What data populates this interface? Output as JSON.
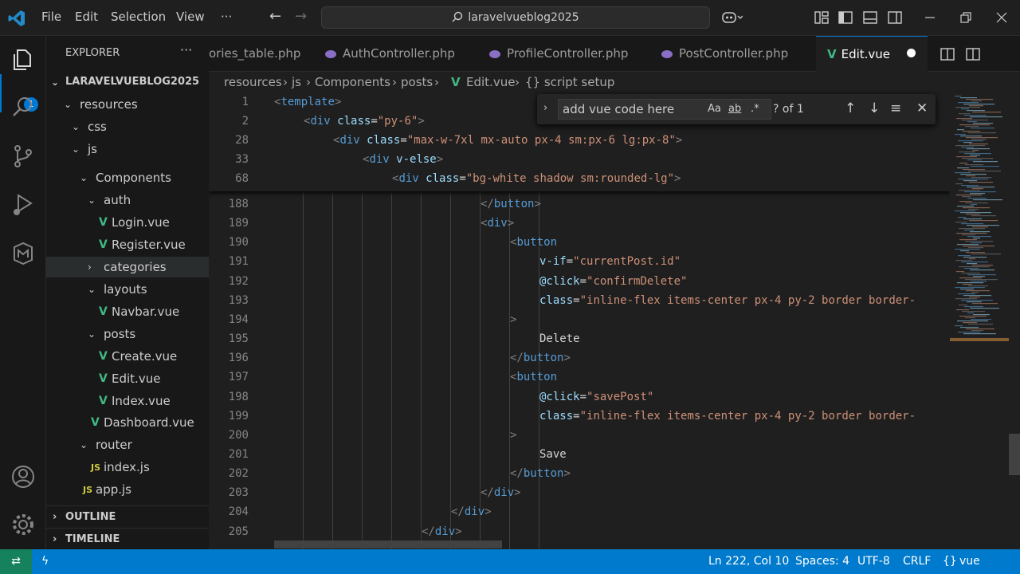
{
  "menu": [
    "File",
    "Edit",
    "Selection",
    "View",
    "···"
  ],
  "search": {
    "text": "laravelvueblog2025"
  },
  "activity": {
    "badge": "1"
  },
  "explorer": {
    "title": "EXPLORER",
    "more": "···",
    "root": "LARAVELVUEBLOG2025",
    "items": [
      {
        "label": "resources",
        "indent": 0,
        "type": "folder"
      },
      {
        "label": "css",
        "indent": 1,
        "type": "folder"
      },
      {
        "label": "js",
        "indent": 1,
        "type": "folder"
      },
      {
        "label": "Components",
        "indent": 2,
        "type": "folder"
      },
      {
        "label": "auth",
        "indent": 3,
        "type": "folder"
      },
      {
        "label": "Login.vue",
        "indent": 4,
        "type": "vue"
      },
      {
        "label": "Register.vue",
        "indent": 4,
        "type": "vue"
      },
      {
        "label": "categories",
        "indent": 3,
        "type": "folder-collapsed"
      },
      {
        "label": "layouts",
        "indent": 3,
        "type": "folder"
      },
      {
        "label": "Navbar.vue",
        "indent": 4,
        "type": "vue"
      },
      {
        "label": "posts",
        "indent": 3,
        "type": "folder"
      },
      {
        "label": "Create.vue",
        "indent": 4,
        "type": "vue"
      },
      {
        "label": "Edit.vue",
        "indent": 4,
        "type": "vue"
      },
      {
        "label": "Index.vue",
        "indent": 4,
        "type": "vue"
      },
      {
        "label": "Dashboard.vue",
        "indent": 3,
        "type": "vue"
      },
      {
        "label": "router",
        "indent": 2,
        "type": "folder"
      },
      {
        "label": "index.js",
        "indent": 3,
        "type": "js"
      },
      {
        "label": "app.js",
        "indent": 2,
        "type": "js"
      }
    ],
    "outline": "OUTLINE",
    "timeline": "TIMELINE"
  },
  "tabs": [
    {
      "label": "ories_table.php"
    },
    {
      "label": "AuthController.php"
    },
    {
      "label": "ProfileController.php"
    },
    {
      "label": "PostController.php"
    },
    {
      "label": "Edit.vue"
    }
  ],
  "breadcrumb": [
    "resources",
    "js",
    "Components",
    "posts",
    "Edit.vue",
    "{} script setup"
  ],
  "find": {
    "value": "add vue code here",
    "case": "Aa",
    "word": "ab",
    "regex": ".*",
    "count": "? of 1"
  },
  "sticky": [
    {
      "n": "1",
      "code": [
        [
          "p",
          "<"
        ],
        [
          "t",
          "template"
        ],
        [
          "p",
          ">"
        ]
      ]
    },
    {
      "n": "2",
      "code": [
        [
          "p",
          "<"
        ],
        [
          "t",
          "div "
        ],
        [
          "a",
          "class"
        ],
        [
          "txt",
          "="
        ],
        [
          "s",
          "\"py-6\""
        ],
        [
          "p",
          ">"
        ]
      ]
    },
    {
      "n": "28",
      "code": [
        [
          "p",
          "<"
        ],
        [
          "t",
          "div "
        ],
        [
          "a",
          "class"
        ],
        [
          "txt",
          "="
        ],
        [
          "s",
          "\"max-w-7xl mx-auto px-4 sm:px-6 lg:px-8\""
        ],
        [
          "p",
          ">"
        ]
      ]
    },
    {
      "n": "33",
      "code": [
        [
          "p",
          "<"
        ],
        [
          "t",
          "div "
        ],
        [
          "a",
          "v-else"
        ],
        [
          "p",
          ">"
        ]
      ]
    },
    {
      "n": "68",
      "code": [
        [
          "p",
          "<"
        ],
        [
          "t",
          "div "
        ],
        [
          "a",
          "class"
        ],
        [
          "txt",
          "="
        ],
        [
          "s",
          "\"bg-white shadow sm:rounded-lg\""
        ],
        [
          "p",
          ">"
        ]
      ]
    }
  ],
  "lines": [
    {
      "n": "188",
      "code": [
        [
          "p",
          "</"
        ],
        [
          "t",
          "button"
        ],
        [
          "p",
          ">"
        ]
      ]
    },
    {
      "n": "189",
      "code": [
        [
          "p",
          "<"
        ],
        [
          "t",
          "div"
        ],
        [
          "p",
          ">"
        ]
      ]
    },
    {
      "n": "190",
      "code": [
        [
          "p",
          "<"
        ],
        [
          "t",
          "button"
        ]
      ]
    },
    {
      "n": "191",
      "code": [
        [
          "a",
          "v-if"
        ],
        [
          "txt",
          "="
        ],
        [
          "s",
          "\"currentPost.id\""
        ]
      ]
    },
    {
      "n": "192",
      "code": [
        [
          "a",
          "@click"
        ],
        [
          "txt",
          "="
        ],
        [
          "s",
          "\"confirmDelete\""
        ]
      ]
    },
    {
      "n": "193",
      "code": [
        [
          "a",
          "class"
        ],
        [
          "txt",
          "="
        ],
        [
          "s",
          "\"inline-flex items-center px-4 py-2 border border-"
        ]
      ]
    },
    {
      "n": "194",
      "code": [
        [
          "p",
          ">"
        ]
      ]
    },
    {
      "n": "195",
      "code": [
        [
          "txt",
          "Delete"
        ]
      ]
    },
    {
      "n": "196",
      "code": [
        [
          "p",
          "</"
        ],
        [
          "t",
          "button"
        ],
        [
          "p",
          ">"
        ]
      ]
    },
    {
      "n": "197",
      "code": [
        [
          "p",
          "<"
        ],
        [
          "t",
          "button"
        ]
      ]
    },
    {
      "n": "198",
      "code": [
        [
          "a",
          "@click"
        ],
        [
          "txt",
          "="
        ],
        [
          "s",
          "\"savePost\""
        ]
      ]
    },
    {
      "n": "199",
      "code": [
        [
          "a",
          "class"
        ],
        [
          "txt",
          "="
        ],
        [
          "s",
          "\"inline-flex items-center px-4 py-2 border border-"
        ]
      ]
    },
    {
      "n": "200",
      "code": [
        [
          "p",
          ">"
        ]
      ]
    },
    {
      "n": "201",
      "code": [
        [
          "txt",
          "Save"
        ]
      ]
    },
    {
      "n": "202",
      "code": [
        [
          "p",
          "</"
        ],
        [
          "t",
          "button"
        ],
        [
          "p",
          ">"
        ]
      ]
    },
    {
      "n": "203",
      "code": [
        [
          "p",
          "</"
        ],
        [
          "t",
          "div"
        ],
        [
          "p",
          ">"
        ]
      ]
    },
    {
      "n": "204",
      "code": [
        [
          "p",
          "</"
        ],
        [
          "t",
          "div"
        ],
        [
          "p",
          ">"
        ]
      ]
    },
    {
      "n": "205",
      "code": [
        [
          "p",
          "</"
        ],
        [
          "t",
          "div"
        ],
        [
          "p",
          ">"
        ]
      ]
    }
  ],
  "status": {
    "position": "Ln 222, Col 10",
    "spaces": "Spaces: 4",
    "encoding": "UTF-8",
    "eol": "CRLF",
    "language": "vue"
  },
  "colors": {
    "accent": "#007acc",
    "vue": "#41b883",
    "tag": "#569cd6",
    "attr": "#9cdcfe",
    "string": "#ce9178"
  }
}
